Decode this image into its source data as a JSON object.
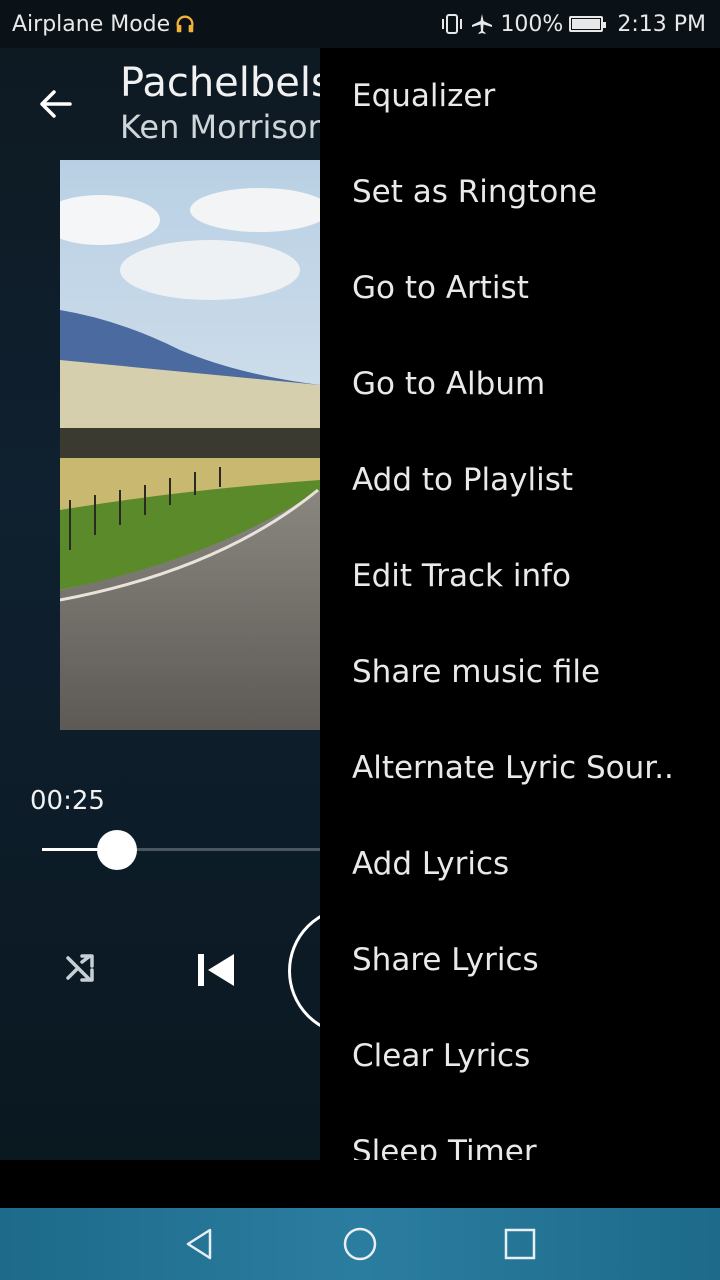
{
  "status_bar": {
    "left_text": "Airplane Mode",
    "battery_text": "100%",
    "battery_level": 1.0,
    "time": "2:13 PM",
    "icons": [
      "headphones-icon",
      "vibrate-icon",
      "airplane-icon",
      "battery-icon"
    ]
  },
  "player": {
    "title": "Pachelbels",
    "artist": "Ken Morrisor",
    "elapsed": "00:25",
    "progress": 0.27
  },
  "menu": {
    "items": [
      {
        "label": "Equalizer"
      },
      {
        "label": "Set as Ringtone"
      },
      {
        "label": "Go to Artist"
      },
      {
        "label": "Go to Album"
      },
      {
        "label": "Add to Playlist"
      },
      {
        "label": "Edit Track info"
      },
      {
        "label": "Share music file"
      },
      {
        "label": "Alternate Lyric Sour.."
      },
      {
        "label": "Add Lyrics"
      },
      {
        "label": "Share Lyrics"
      },
      {
        "label": "Clear Lyrics"
      },
      {
        "label": "Sleep Timer"
      }
    ]
  },
  "colors": {
    "nav_bar": "#2b7da0",
    "menu_bg": "#000000",
    "accent": "#ffffff"
  }
}
